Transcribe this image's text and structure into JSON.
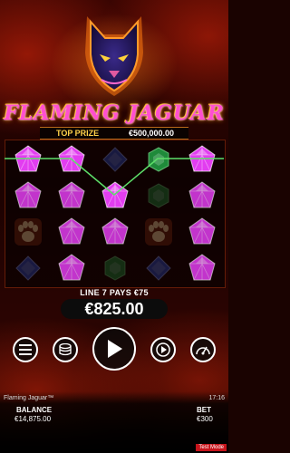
{
  "game": {
    "logo_text": "FLAMING JAGUAR",
    "top_prize_label": "TOP PRIZE",
    "top_prize_value": "€500,000.00"
  },
  "win": {
    "line_text": "LINE 7 PAYS €75",
    "amount": "€825.00"
  },
  "controls": [
    {
      "name": "menu-button",
      "icon": "hamburger-icon"
    },
    {
      "name": "bet-button",
      "icon": "coin-stack-icon"
    },
    {
      "name": "spin-button",
      "icon": "play-icon"
    },
    {
      "name": "autoplay-button",
      "icon": "autoplay-icon"
    },
    {
      "name": "turbo-button",
      "icon": "speedometer-icon"
    }
  ],
  "footer": {
    "game_name": "Flaming Jaguar™",
    "clock": "17:16",
    "balance_label": "BALANCE",
    "balance_value": "€14,875.00",
    "bet_label": "BET",
    "bet_value": "€300",
    "test_mode": "Test Mode"
  },
  "reels": {
    "rows": [
      [
        "pink-gem",
        "pink-gem",
        "blue-gem",
        "green-gem",
        "pink-gem"
      ],
      [
        "pink-gem",
        "pink-gem",
        "pink-gem",
        "green-gem",
        "pink-gem"
      ],
      [
        "paw",
        "pink-gem",
        "pink-gem",
        "paw",
        "pink-gem"
      ],
      [
        "blue-gem",
        "pink-gem",
        "green-gem",
        "blue-gem",
        "pink-gem"
      ]
    ],
    "highlighted": [
      [
        0,
        0
      ],
      [
        0,
        1
      ],
      [
        1,
        2
      ],
      [
        0,
        3
      ],
      [
        0,
        4
      ]
    ],
    "colors": {
      "pink-gem": "#e23df0",
      "blue-gem": "#2b4cc4",
      "green-gem": "#1f8a3a",
      "paw": "#c4471a",
      "payline": "#5ee06a"
    }
  }
}
